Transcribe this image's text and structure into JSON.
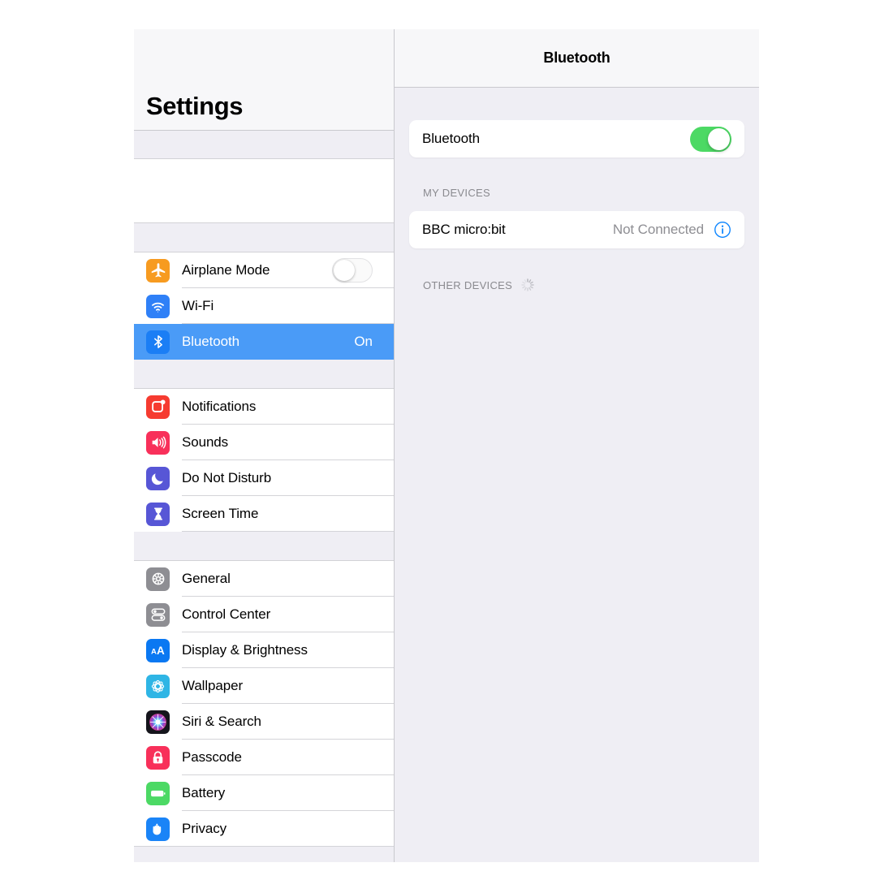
{
  "sidebar": {
    "title": "Settings",
    "groups": [
      {
        "rows": [
          {
            "label": "Airplane Mode",
            "icon": "airplane-icon",
            "icon_bg": "#f79b20",
            "control": "toggle-off",
            "value": ""
          },
          {
            "label": "Wi-Fi",
            "icon": "wifi-icon",
            "icon_bg": "#2f80f7",
            "control": "none",
            "value": ""
          },
          {
            "label": "Bluetooth",
            "icon": "bluetooth-icon",
            "icon_bg": "#2f80f7",
            "control": "value",
            "value": "On",
            "selected": true
          }
        ]
      },
      {
        "rows": [
          {
            "label": "Notifications",
            "icon": "notifications-icon",
            "icon_bg": "#f63b30",
            "control": "none",
            "value": ""
          },
          {
            "label": "Sounds",
            "icon": "sounds-icon",
            "icon_bg": "#f8305a",
            "control": "none",
            "value": ""
          },
          {
            "label": "Do Not Disturb",
            "icon": "do-not-disturb-icon",
            "icon_bg": "#5756d6",
            "control": "none",
            "value": ""
          },
          {
            "label": "Screen Time",
            "icon": "screen-time-icon",
            "icon_bg": "#5756d6",
            "control": "none",
            "value": ""
          }
        ]
      },
      {
        "rows": [
          {
            "label": "General",
            "icon": "gear-icon",
            "icon_bg": "#8e8e93",
            "control": "none",
            "value": ""
          },
          {
            "label": "Control Center",
            "icon": "control-center-icon",
            "icon_bg": "#8e8e93",
            "control": "none",
            "value": ""
          },
          {
            "label": "Display & Brightness",
            "icon": "display-brightness-icon",
            "icon_bg": "#0a78f2",
            "control": "none",
            "value": ""
          },
          {
            "label": "Wallpaper",
            "icon": "wallpaper-icon",
            "icon_bg": "#2eb5e5",
            "control": "none",
            "value": ""
          },
          {
            "label": "Siri & Search",
            "icon": "siri-icon",
            "icon_bg": "#1c1c22",
            "control": "none",
            "value": ""
          },
          {
            "label": "Passcode",
            "icon": "passcode-lock-icon",
            "icon_bg": "#f8305a",
            "control": "none",
            "value": ""
          },
          {
            "label": "Battery",
            "icon": "battery-icon",
            "icon_bg": "#4cd964",
            "control": "none",
            "value": ""
          },
          {
            "label": "Privacy",
            "icon": "privacy-hand-icon",
            "icon_bg": "#1a84f7",
            "control": "none",
            "value": ""
          }
        ]
      }
    ]
  },
  "detail": {
    "nav_title": "Bluetooth",
    "bluetooth_row": {
      "label": "Bluetooth",
      "toggle_state": "on"
    },
    "my_devices": {
      "header": "MY DEVICES",
      "devices": [
        {
          "name": "BBC micro:bit",
          "status": "Not Connected",
          "info_icon": "info-circle-icon"
        }
      ]
    },
    "other_devices": {
      "header": "OTHER DEVICES",
      "spinner": "loading-spinner-icon"
    }
  },
  "colors": {
    "accent_blue": "#007aff",
    "selected_row_blue": "#4a9bf7",
    "toggle_on_green": "#4cd964",
    "group_bg": "#efeef4",
    "nav_bg": "#f7f7f9",
    "secondary_text": "#8e8e93"
  }
}
